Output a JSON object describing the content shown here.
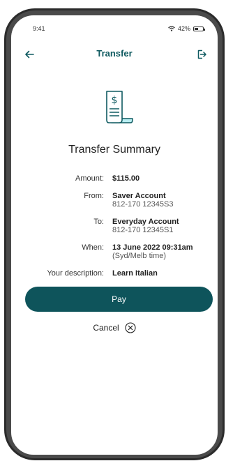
{
  "status": {
    "time": "9:41",
    "battery_text": "42%",
    "battery_level": 0.42
  },
  "header": {
    "title": "Transfer",
    "back_icon": "arrow-left-icon",
    "exit_icon": "logout-icon"
  },
  "summary": {
    "icon": "receipt-dollar-icon",
    "title": "Transfer Summary",
    "rows": [
      {
        "label": "Amount:",
        "value": "$115.00",
        "sub": ""
      },
      {
        "label": "From:",
        "value": "Saver Account",
        "sub": "812-170  12345S3"
      },
      {
        "label": "To:",
        "value": "Everyday Account",
        "sub": "812-170  12345S1"
      },
      {
        "label": "When:",
        "value": "13 June 2022 09:31am",
        "sub": "(Syd/Melb time)"
      },
      {
        "label": "Your description:",
        "value": "Learn Italian",
        "sub": ""
      }
    ]
  },
  "actions": {
    "pay_label": "Pay",
    "cancel_label": "Cancel",
    "cancel_icon": "circle-x-icon"
  },
  "colors": {
    "accent": "#0e545b",
    "title": "#0f5a60",
    "icon_highlight": "#b9eef2"
  }
}
